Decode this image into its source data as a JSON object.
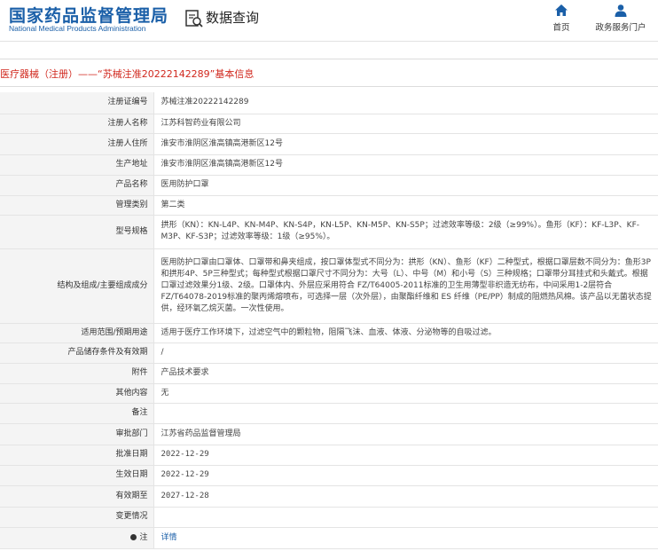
{
  "header": {
    "logo_cn": "国家药品监督管理局",
    "logo_en": "National Medical Products Administration",
    "section_title": "数据查询",
    "nav_home": "首页",
    "nav_portal": "政务服务门户"
  },
  "title": "医疗器械（注册）——“苏械注准20222142289”基本信息",
  "fields": {
    "reg_no": {
      "label": "注册证编号",
      "value": "苏械注准20222142289"
    },
    "registrant": {
      "label": "注册人名称",
      "value": "江苏科智药业有限公司"
    },
    "registrant_addr": {
      "label": "注册人住所",
      "value": "淮安市淮阴区淮高镇高港新区12号"
    },
    "production_addr": {
      "label": "生产地址",
      "value": "淮安市淮阴区淮高镇高港新区12号"
    },
    "product_name": {
      "label": "产品名称",
      "value": "医用防护口罩"
    },
    "category": {
      "label": "管理类别",
      "value": "第二类"
    },
    "models": {
      "label": "型号规格",
      "value": "拱形（KN）：KN-L4P、KN-M4P、KN-S4P，KN-L5P、KN-M5P、KN-S5P；过滤效率等级：2级（≥99%）。鱼形（KF）：KF-L3P、KF-M3P、KF-S3P；过滤效率等级：1级（≥95%）。"
    },
    "structure": {
      "label": "结构及组成/主要组成成分",
      "value": "医用防护口罩由口罩体、口罩带和鼻夹组成，按口罩体型式不同分为：拱形（KN）、鱼形（KF）二种型式，根据口罩层数不同分为：鱼形3P和拱形4P、5P三种型式；每种型式根据口罩尺寸不同分为：大号（L）、中号（M）和小号（S）三种规格；口罩带分耳挂式和头戴式。根据口罩过滤效果分1级、2级。口罩体内、外层应采用符合 FZ/T64005-2011标准的卫生用薄型非织造无纺布，中间采用1-2层符合 FZ/T64078-2019标准的聚丙烯熔喷布，可选择一层（次外层），由聚酯纤维和 ES 纤维（PE/PP）制成的阻燃热风棉。该产品以无菌状态提供，经环氧乙烷灭菌。一次性使用。"
    },
    "scope": {
      "label": "适用范围/预期用途",
      "value": "适用于医疗工作环境下，过滤空气中的颗粒物，阻隔飞沫、血液、体液、分泌物等的自吸过滤。"
    },
    "storage": {
      "label": "产品储存条件及有效期",
      "value": "/"
    },
    "attachment": {
      "label": "附件",
      "value": "产品技术要求"
    },
    "other": {
      "label": "其他内容",
      "value": "无"
    },
    "remark": {
      "label": "备注",
      "value": ""
    },
    "approval_dept": {
      "label": "审批部门",
      "value": "江苏省药品监督管理局"
    },
    "approval_date": {
      "label": "批准日期",
      "value": "2022-12-29"
    },
    "effective_date": {
      "label": "生效日期",
      "value": "2022-12-29"
    },
    "expiry_date": {
      "label": "有效期至",
      "value": "2027-12-28"
    },
    "changes": {
      "label": "变更情况",
      "value": ""
    },
    "note": {
      "label": "注",
      "value": "详情"
    }
  }
}
